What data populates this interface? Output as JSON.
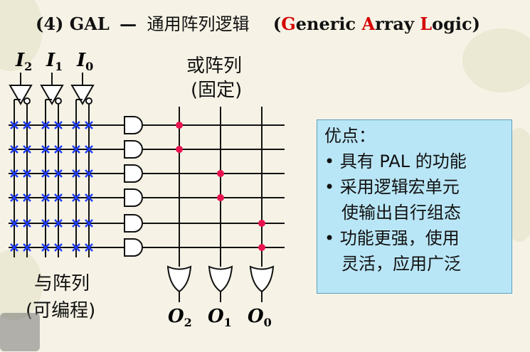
{
  "title": {
    "prefix": "(4) GAL",
    "dash": "—",
    "chinese": "通用阵列逻辑",
    "open": "(",
    "g": "G",
    "eneric": "eneric ",
    "a": "A",
    "rray": "rray ",
    "l": "L",
    "ogic": "ogic",
    "close": ")"
  },
  "inputs": [
    {
      "name": "I",
      "sub": "2"
    },
    {
      "name": "I",
      "sub": "1"
    },
    {
      "name": "I",
      "sub": "0"
    }
  ],
  "or_array": {
    "line1": "或阵列",
    "line2": "(固定)"
  },
  "and_array": {
    "line1": "与阵列",
    "line2": "(可编程)"
  },
  "outputs": [
    {
      "name": "O",
      "sub": "2"
    },
    {
      "name": "O",
      "sub": "1"
    },
    {
      "name": "O",
      "sub": "0"
    }
  ],
  "advantages": {
    "heading": "优点：",
    "items": [
      "• 具有 PAL 的功能",
      "• 采用逻辑宏单元",
      "使输出自行组态",
      "• 功能更强，使用",
      "灵活，应用广泛"
    ]
  },
  "colors": {
    "cross": "#1e3cff",
    "dot": "#e8144f",
    "accent": "#d40000",
    "box": "#b9e6f6"
  }
}
